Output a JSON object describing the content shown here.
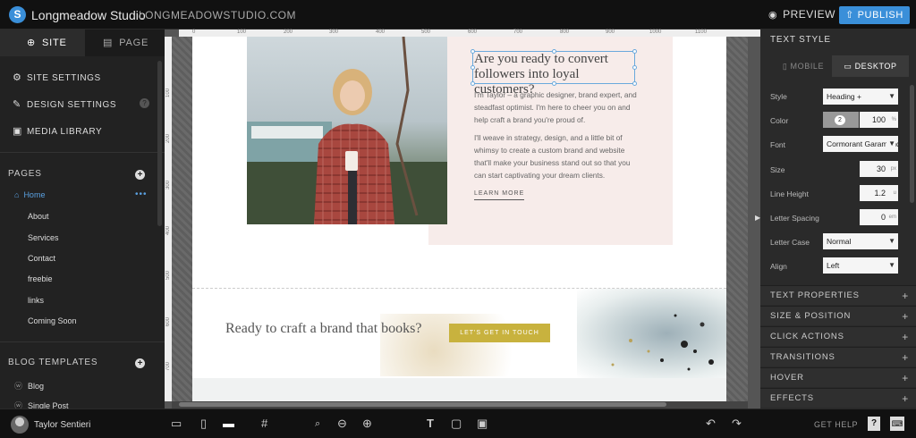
{
  "app": {
    "logo_glyph": "S",
    "title": "Longmeadow Studio",
    "url": "LONGMEADOWSTUDIO.COM",
    "preview_label": "PREVIEW",
    "publish_label": "PUBLISH",
    "accent_color": "#3a8fd9"
  },
  "sidebar": {
    "tabs": [
      {
        "label": "SITE",
        "icon": "globe-icon"
      },
      {
        "label": "PAGE",
        "icon": "page-icon"
      }
    ],
    "nav": [
      {
        "label": "SITE SETTINGS",
        "icon": "gear-icon"
      },
      {
        "label": "DESIGN SETTINGS",
        "icon": "brush-icon"
      },
      {
        "label": "MEDIA LIBRARY",
        "icon": "image-icon"
      }
    ],
    "help_glyph": "?",
    "pages_header": "PAGES",
    "add_glyph": "+",
    "pages": [
      "Home",
      "About",
      "Services",
      "Contact",
      "freebie",
      "links",
      "Coming Soon"
    ],
    "home_menu_glyph": "•••",
    "blog_header": "BLOG TEMPLATES",
    "blog_templates": [
      "Blog",
      "Single Post"
    ]
  },
  "rulers": {
    "top": [
      "0",
      "100",
      "200",
      "300",
      "400",
      "500",
      "600",
      "700",
      "800",
      "900",
      "1000",
      "1100"
    ],
    "left": [
      "100",
      "200",
      "300",
      "400",
      "500",
      "600",
      "700"
    ]
  },
  "canvas": {
    "heading": "Are you ready to convert followers into loyal customers?",
    "para1": "I'm Taylor – a graphic designer, brand expert, and steadfast optimist. I'm here to cheer you on and help craft a brand you're proud of.",
    "para2": "I'll weave in strategy, design, and a little bit of whimsy to create a custom brand and website that'll make your business stand out so that you can start captivating your dream clients.",
    "learn_more": "LEARN MORE",
    "banner_text": "Ready to craft a brand that books?",
    "cta_label": "LET'S GET IN TOUCH",
    "cta_color": "#c8b23e",
    "panel_bg_color": "#f7ecea"
  },
  "right_panel": {
    "title": "TEXT STYLE",
    "tab_mobile": "MOBILE",
    "tab_desktop": "DESKTOP",
    "style_label": "Style",
    "style_value": "Heading +",
    "color_label": "Color",
    "color_index": "2",
    "color_opacity": "100",
    "color_opacity_unit": "%",
    "font_label": "Font",
    "font_value": "Cormorant Garamond",
    "size_label": "Size",
    "size_value": "30",
    "size_unit": "px",
    "line_height_label": "Line Height",
    "line_height_value": "1.2",
    "line_height_unit": "u",
    "letter_spacing_label": "Letter Spacing",
    "letter_spacing_value": "0",
    "letter_spacing_unit": "em",
    "letter_case_label": "Letter Case",
    "letter_case_value": "Normal",
    "align_label": "Align",
    "align_value": "Left",
    "sections": [
      "TEXT PROPERTIES",
      "SIZE & POSITION",
      "CLICK ACTIONS",
      "TRANSITIONS",
      "HOVER",
      "EFFECTS"
    ],
    "plus_glyph": "+",
    "collapse_glyph": "▶"
  },
  "bottom": {
    "user_name": "Taylor Sentieri",
    "get_help": "GET HELP",
    "help_glyph": "?",
    "keyboard_glyph": "⌨",
    "undo_glyph": "↶",
    "redo_glyph": "↷"
  }
}
